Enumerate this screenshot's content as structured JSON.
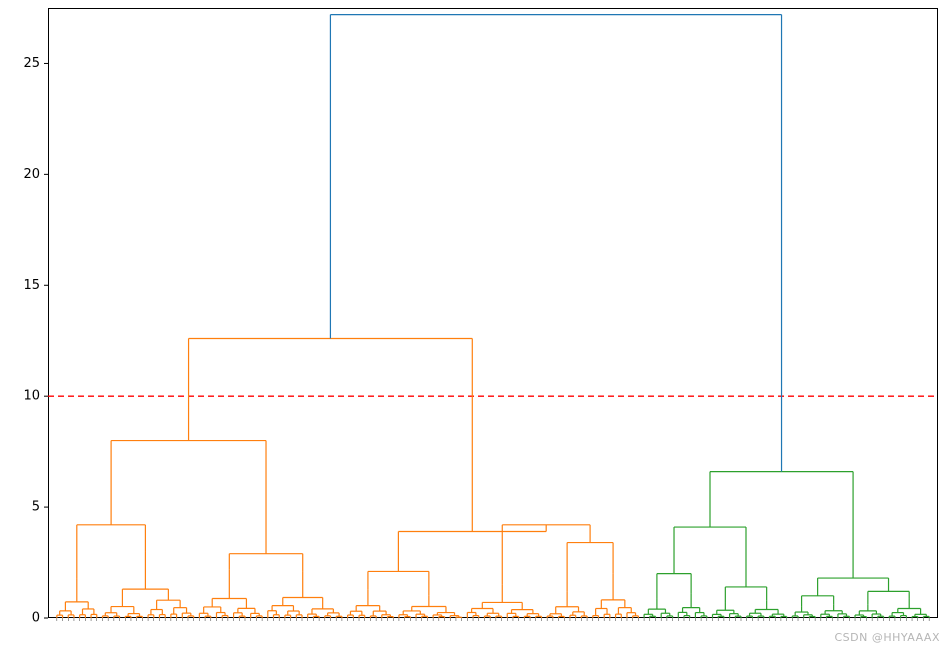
{
  "chart_data": {
    "type": "dendrogram",
    "title": "",
    "xlabel": "",
    "ylabel": "",
    "ylim": [
      0,
      27.5
    ],
    "yticks": [
      0,
      5,
      10,
      15,
      20,
      25
    ],
    "threshold_line": {
      "y": 10,
      "color": "#ff0000",
      "style": "dashed"
    },
    "colors": {
      "above_threshold": "#1f77b4",
      "left_subcluster": "#ff7f0e",
      "right_subcluster": "#2ca02c"
    },
    "root": {
      "height": 27.2,
      "color": "above_threshold",
      "children": [
        {
          "height": 12.6,
          "color": "left_subcluster",
          "leaf_fraction": 0.67,
          "children": [
            {
              "height": 8.0,
              "leaf_fraction": 0.33,
              "children": [
                {
                  "height": 4.2,
                  "leaf_fraction": 0.16,
                  "children": [
                    {
                      "height": 1.8,
                      "leaf_fraction": 0.05,
                      "children": []
                    },
                    {
                      "height": 3.0,
                      "leaf_fraction": 0.11,
                      "children": []
                    }
                  ]
                },
                {
                  "height": 2.9,
                  "leaf_fraction": 0.17,
                  "children": [
                    {
                      "height": 2.2,
                      "leaf_fraction": 0.08,
                      "children": []
                    },
                    {
                      "height": 2.1,
                      "leaf_fraction": 0.09,
                      "children": []
                    }
                  ]
                }
              ]
            },
            {
              "height": 3.9,
              "leaf_fraction": 0.34,
              "children": [
                {
                  "height": 2.1,
                  "leaf_fraction": 0.14,
                  "children": [
                    {
                      "height": 1.3,
                      "leaf_fraction": 0.06,
                      "children": []
                    },
                    {
                      "height": 1.0,
                      "leaf_fraction": 0.08,
                      "children": []
                    }
                  ]
                },
                {
                  "height": 4.2,
                  "leaf_fraction": 0.2,
                  "children": [
                    {
                      "height": 1.5,
                      "leaf_fraction": 0.09,
                      "children": []
                    },
                    {
                      "height": 3.4,
                      "leaf_fraction": 0.11,
                      "children": [
                        {
                          "height": 1.2,
                          "leaf_fraction": 0.05,
                          "children": []
                        },
                        {
                          "height": 2.0,
                          "leaf_fraction": 0.06,
                          "children": []
                        }
                      ]
                    }
                  ]
                }
              ]
            }
          ]
        },
        {
          "height": 6.6,
          "color": "right_subcluster",
          "leaf_fraction": 0.33,
          "children": [
            {
              "height": 4.1,
              "leaf_fraction": 0.17,
              "children": [
                {
                  "height": 2.0,
                  "leaf_fraction": 0.08,
                  "children": [
                    {
                      "height": 0.9,
                      "leaf_fraction": 0.04,
                      "children": []
                    },
                    {
                      "height": 1.1,
                      "leaf_fraction": 0.04,
                      "children": []
                    }
                  ]
                },
                {
                  "height": 1.4,
                  "leaf_fraction": 0.09,
                  "children": [
                    {
                      "height": 0.7,
                      "leaf_fraction": 0.04,
                      "children": []
                    },
                    {
                      "height": 0.8,
                      "leaf_fraction": 0.05,
                      "children": []
                    }
                  ]
                }
              ]
            },
            {
              "height": 1.8,
              "leaf_fraction": 0.16,
              "children": [
                {
                  "height": 1.0,
                  "leaf_fraction": 0.07,
                  "children": [
                    {
                      "height": 0.5,
                      "leaf_fraction": 0.03,
                      "children": []
                    },
                    {
                      "height": 0.6,
                      "leaf_fraction": 0.04,
                      "children": []
                    }
                  ]
                },
                {
                  "height": 1.2,
                  "leaf_fraction": 0.09,
                  "children": [
                    {
                      "height": 0.6,
                      "leaf_fraction": 0.04,
                      "children": []
                    },
                    {
                      "height": 0.9,
                      "leaf_fraction": 0.05,
                      "children": []
                    }
                  ]
                }
              ]
            }
          ]
        }
      ]
    },
    "leaf_count_approx": 150
  },
  "watermark": "CSDN @HHYAAAX"
}
